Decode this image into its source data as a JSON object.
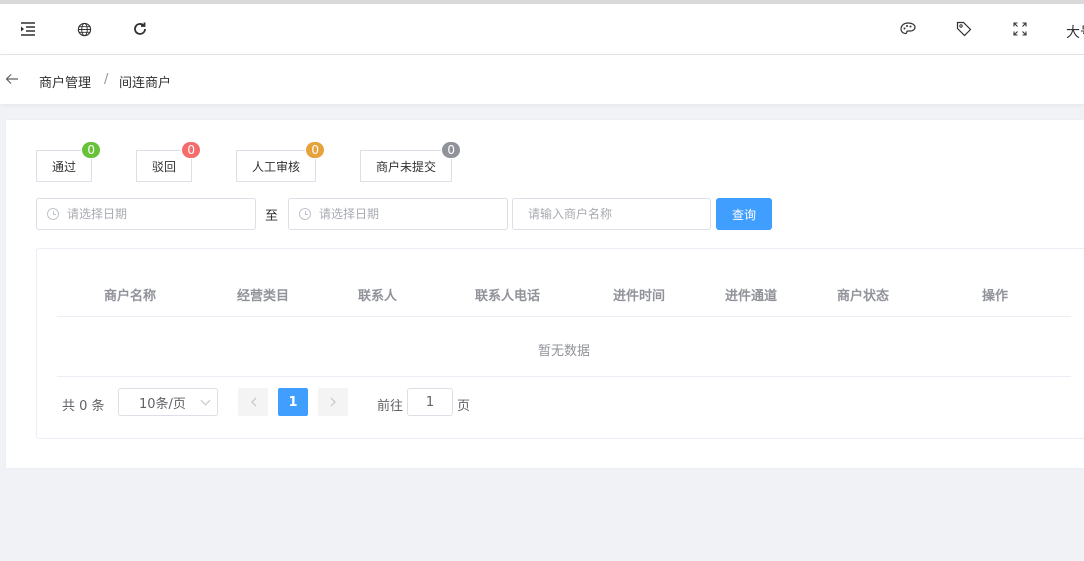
{
  "topbar": {
    "right_text": "大号"
  },
  "breadcrumb": {
    "items": [
      "商户管理",
      "间连商户"
    ],
    "separator": "/"
  },
  "status_filters": [
    {
      "label": "通过",
      "count": "0",
      "color": "#67c23a"
    },
    {
      "label": "驳回",
      "count": "0",
      "color": "#f56c6c"
    },
    {
      "label": "人工审核",
      "count": "0",
      "color": "#e6a23c"
    },
    {
      "label": "商户未提交",
      "count": "0",
      "color": "#909399"
    }
  ],
  "search": {
    "start_date_placeholder": "请选择日期",
    "to_label": "至",
    "end_date_placeholder": "请选择日期",
    "merchant_name_placeholder": "请输入商户名称",
    "query_label": "查询"
  },
  "table": {
    "columns": [
      "商户名称",
      "经营类目",
      "联系人",
      "联系人电话",
      "进件时间",
      "进件通道",
      "商户状态",
      "操作"
    ],
    "empty_text": "暂无数据"
  },
  "pagination": {
    "total_text": "共 0 条",
    "page_size": "10条/页",
    "current_page": "1",
    "goto_prefix": "前往",
    "goto_value": "1",
    "goto_suffix": "页"
  },
  "colors": {
    "primary": "#409eff"
  }
}
